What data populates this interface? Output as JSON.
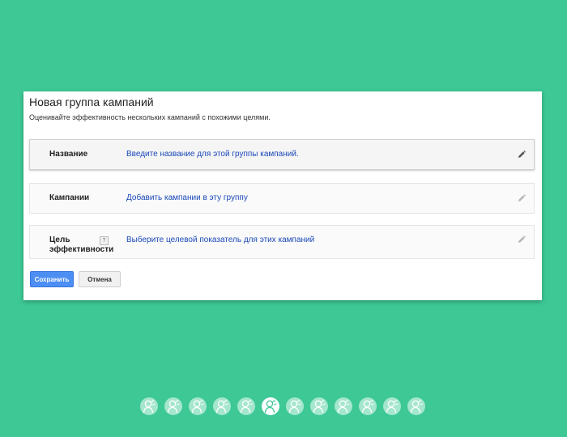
{
  "panel": {
    "title": "Новая группа кампаний",
    "subtitle": "Оценивайте эффективность нескольких кампаний с похожими целями."
  },
  "rows": [
    {
      "label": "Название",
      "value": "Введите название для этой группы кампаний.",
      "icon": "pencil-icon",
      "active": true
    },
    {
      "label": "Кампании",
      "value": "Добавить кампании в эту группу",
      "icon": "pencil-icon",
      "active": false
    },
    {
      "label": "Цель эффективности",
      "help": "?",
      "value": "Выберите целевой показатель для этих кампаний",
      "icon": "pencil-icon",
      "active": false
    }
  ],
  "buttons": {
    "save": "Сохранить",
    "cancel": "Отмена"
  },
  "pager": {
    "count": 12,
    "active_index": 5,
    "icon": "person-icon"
  },
  "colors": {
    "background": "#3dc896",
    "link": "#1a48b8",
    "save_button": "#4d8ef3"
  }
}
